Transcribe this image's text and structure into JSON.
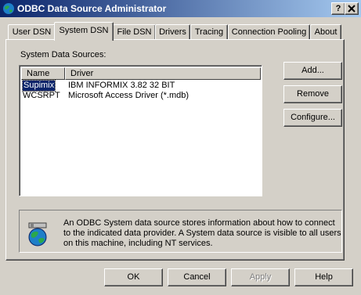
{
  "window": {
    "title": "ODBC Data Source Administrator",
    "help_button": "?",
    "close_button": "X"
  },
  "tabs": [
    {
      "label": "User DSN",
      "active": false
    },
    {
      "label": "System DSN",
      "active": true
    },
    {
      "label": "File DSN",
      "active": false
    },
    {
      "label": "Drivers",
      "active": false
    },
    {
      "label": "Tracing",
      "active": false
    },
    {
      "label": "Connection Pooling",
      "active": false
    },
    {
      "label": "About",
      "active": false
    }
  ],
  "system_dsn": {
    "section_label": "System Data Sources:",
    "columns": [
      "Name",
      "Driver"
    ],
    "rows": [
      {
        "name": "Supimix",
        "driver": "IBM INFORMIX 3.82 32 BIT",
        "selected": true
      },
      {
        "name": "WCSRPT",
        "driver": "Microsoft Access Driver (*.mdb)",
        "selected": false
      }
    ],
    "side_buttons": {
      "add": "Add...",
      "remove": "Remove",
      "configure": "Configure..."
    },
    "info_text": "An ODBC System data source stores information about how to connect to the indicated data provider.  A System data source is visible to all users on this machine, including NT services."
  },
  "footer_buttons": {
    "ok": "OK",
    "cancel": "Cancel",
    "apply": "Apply",
    "help": "Help"
  },
  "colors": {
    "titlebar_start": "#0a246a",
    "titlebar_end": "#a6caf0",
    "face": "#d4d0c8",
    "selection": "#0a246a"
  }
}
